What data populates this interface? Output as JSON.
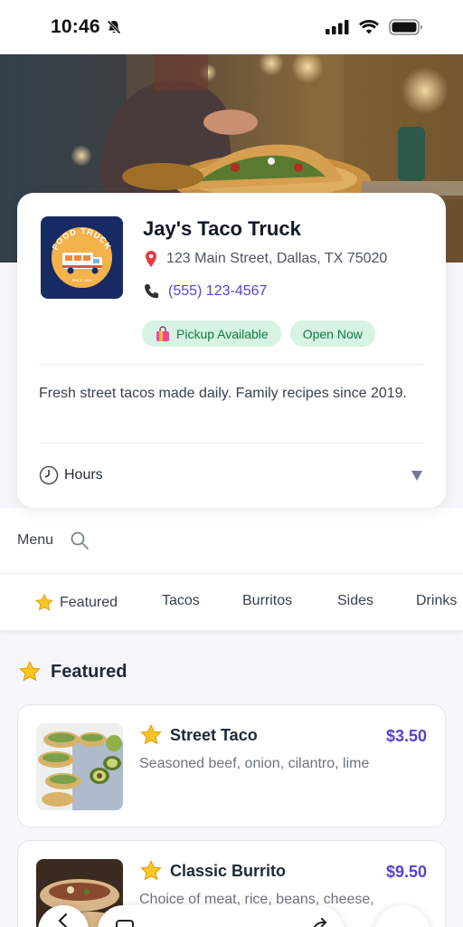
{
  "status_bar": {
    "time": "10:46",
    "icons": [
      "bell-muted-icon",
      "cellular-signal-icon",
      "wifi-icon",
      "battery-icon"
    ]
  },
  "hero": {
    "image": "hero-tacos-photo"
  },
  "restaurant": {
    "logo": {
      "text_top": "FOOD TRUCK",
      "text_bottom": "SINCE 1998"
    },
    "name": "Jay's Taco Truck",
    "address": "123 Main Street, Dallas, TX 75020",
    "address_icon": "pin-icon",
    "phone": "(555) 123-4567",
    "phone_icon": "phone-icon",
    "badges": [
      {
        "label": "Pickup Available",
        "icon": "shopping-bag-icon"
      },
      {
        "label": "Open Now"
      }
    ],
    "description": "Fresh street tacos made daily. Family recipes since 2019.",
    "hours_label": "Hours",
    "hours_icon": "clock-icon"
  },
  "menu_header": {
    "label": "Menu",
    "search_icon": "search-icon"
  },
  "tabs": [
    {
      "label": "Featured",
      "icon": "star-icon"
    },
    {
      "label": "Tacos"
    },
    {
      "label": "Burritos"
    },
    {
      "label": "Sides"
    },
    {
      "label": "Drinks"
    }
  ],
  "section": {
    "title": "Featured",
    "icon": "star-icon"
  },
  "items": [
    {
      "name": "Street Taco",
      "price": "$3.50",
      "description": "Seasoned beef, onion, cilantro, lime",
      "featured_icon": "star-icon"
    },
    {
      "name": "Classic Burrito",
      "price": "$9.50",
      "description": "Choice of meat, rice, beans, cheese,",
      "featured_icon": "star-icon"
    }
  ],
  "colors": {
    "accent": "#5b3fd6",
    "badge_bg": "#d7f3e3",
    "badge_text": "#0f7a45",
    "logo_bg": "#172a63"
  }
}
